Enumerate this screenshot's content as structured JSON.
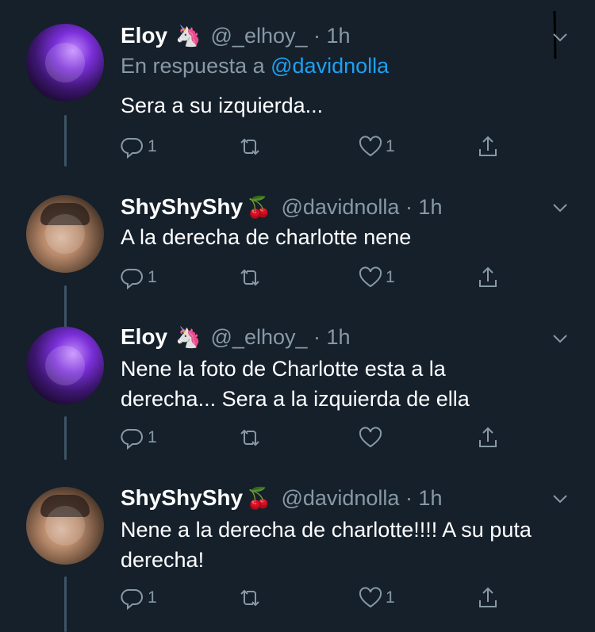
{
  "tweets": [
    {
      "name": "Eloy",
      "emoji": "🦄",
      "handle": "@_elhoy_ · 1h",
      "reply_prefix": "En respuesta a ",
      "reply_mention": "@davidnolla",
      "text": "Sera a su izquierda...",
      "replies": "1",
      "retweets": "",
      "likes": "1"
    },
    {
      "name": "ShyShyShy",
      "emoji": "🍒",
      "handle": "@davidnolla · 1h",
      "text": "A la derecha de charlotte nene",
      "replies": "1",
      "retweets": "",
      "likes": "1"
    },
    {
      "name": "Eloy",
      "emoji": "🦄",
      "handle": "@_elhoy_ · 1h",
      "text": "Nene la foto de Charlotte esta a la derecha... Sera a la izquierda de ella",
      "replies": "1",
      "retweets": "",
      "likes": ""
    },
    {
      "name": "ShyShyShy",
      "emoji": "🍒",
      "handle": "@davidnolla · 1h",
      "text": "Nene a la derecha de charlotte!!!! A su puta derecha!",
      "replies": "1",
      "retweets": "",
      "likes": "1"
    }
  ],
  "icons": {
    "reply": "reply-icon",
    "retweet": "retweet-icon",
    "like": "heart-icon",
    "share": "share-icon",
    "more": "chevron-down-icon"
  },
  "colors": {
    "background": "#15202b",
    "secondary_text": "#8899a6",
    "link": "#1da1f2",
    "thread_line": "#3d5466"
  }
}
